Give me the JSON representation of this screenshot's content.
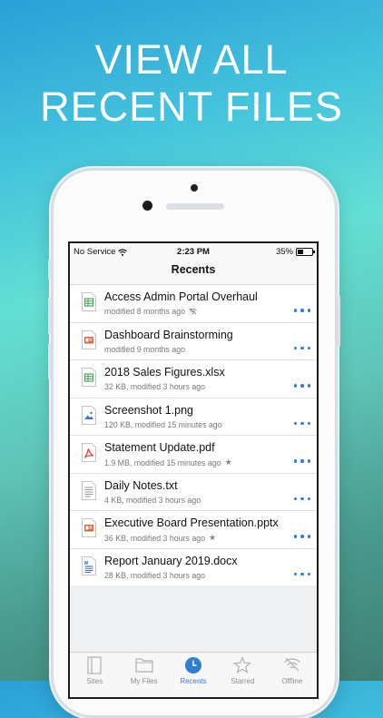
{
  "headline": {
    "line1": "VIEW ALL",
    "line2": "RECENT FILES"
  },
  "status_bar": {
    "carrier": "No Service",
    "time": "2:23 PM",
    "battery": "35%"
  },
  "nav": {
    "title": "Recents"
  },
  "files": [
    {
      "name": "Access Admin Portal Overhaul",
      "meta": "modified 8 months ago",
      "badge": "offline-icon",
      "icon": "spreadsheet-icon"
    },
    {
      "name": "Dashboard Brainstorming",
      "meta": "modified 9 months ago",
      "badge": "",
      "icon": "presentation-icon"
    },
    {
      "name": "2018 Sales Figures.xlsx",
      "meta": "32 KB, modified 3 hours ago",
      "badge": "",
      "icon": "spreadsheet-icon"
    },
    {
      "name": "Screenshot 1.png",
      "meta": "120 KB, modified 15 minutes ago",
      "badge": "",
      "icon": "image-icon"
    },
    {
      "name": "Statement Update.pdf",
      "meta": "1.9 MB, modified 15 minutes ago",
      "badge": "star-icon",
      "icon": "pdf-icon"
    },
    {
      "name": "Daily Notes.txt",
      "meta": "4 KB, modified 3 hours ago",
      "badge": "",
      "icon": "text-file-icon"
    },
    {
      "name": "Executive Board Presentation.pptx",
      "meta": "36 KB, modified 3 hours ago",
      "badge": "star-icon",
      "icon": "presentation-icon"
    },
    {
      "name": "Report January 2019.docx",
      "meta": "28 KB, modified 3 hours ago",
      "badge": "",
      "icon": "word-icon"
    }
  ],
  "tabs": [
    {
      "label": "Sites",
      "icon": "sites-icon",
      "active": false
    },
    {
      "label": "My Files",
      "icon": "folder-icon",
      "active": false
    },
    {
      "label": "Recents",
      "icon": "clock-icon",
      "active": true
    },
    {
      "label": "Starred",
      "icon": "star-icon",
      "active": false
    },
    {
      "label": "Offline",
      "icon": "offline-icon",
      "active": false
    }
  ],
  "colors": {
    "accent": "#2f7fd1",
    "spreadsheet": "#3fa34d",
    "presentation": "#d86a3b",
    "pdf": "#d9382f",
    "image": "#3a78c2",
    "word": "#2b5fb3"
  }
}
